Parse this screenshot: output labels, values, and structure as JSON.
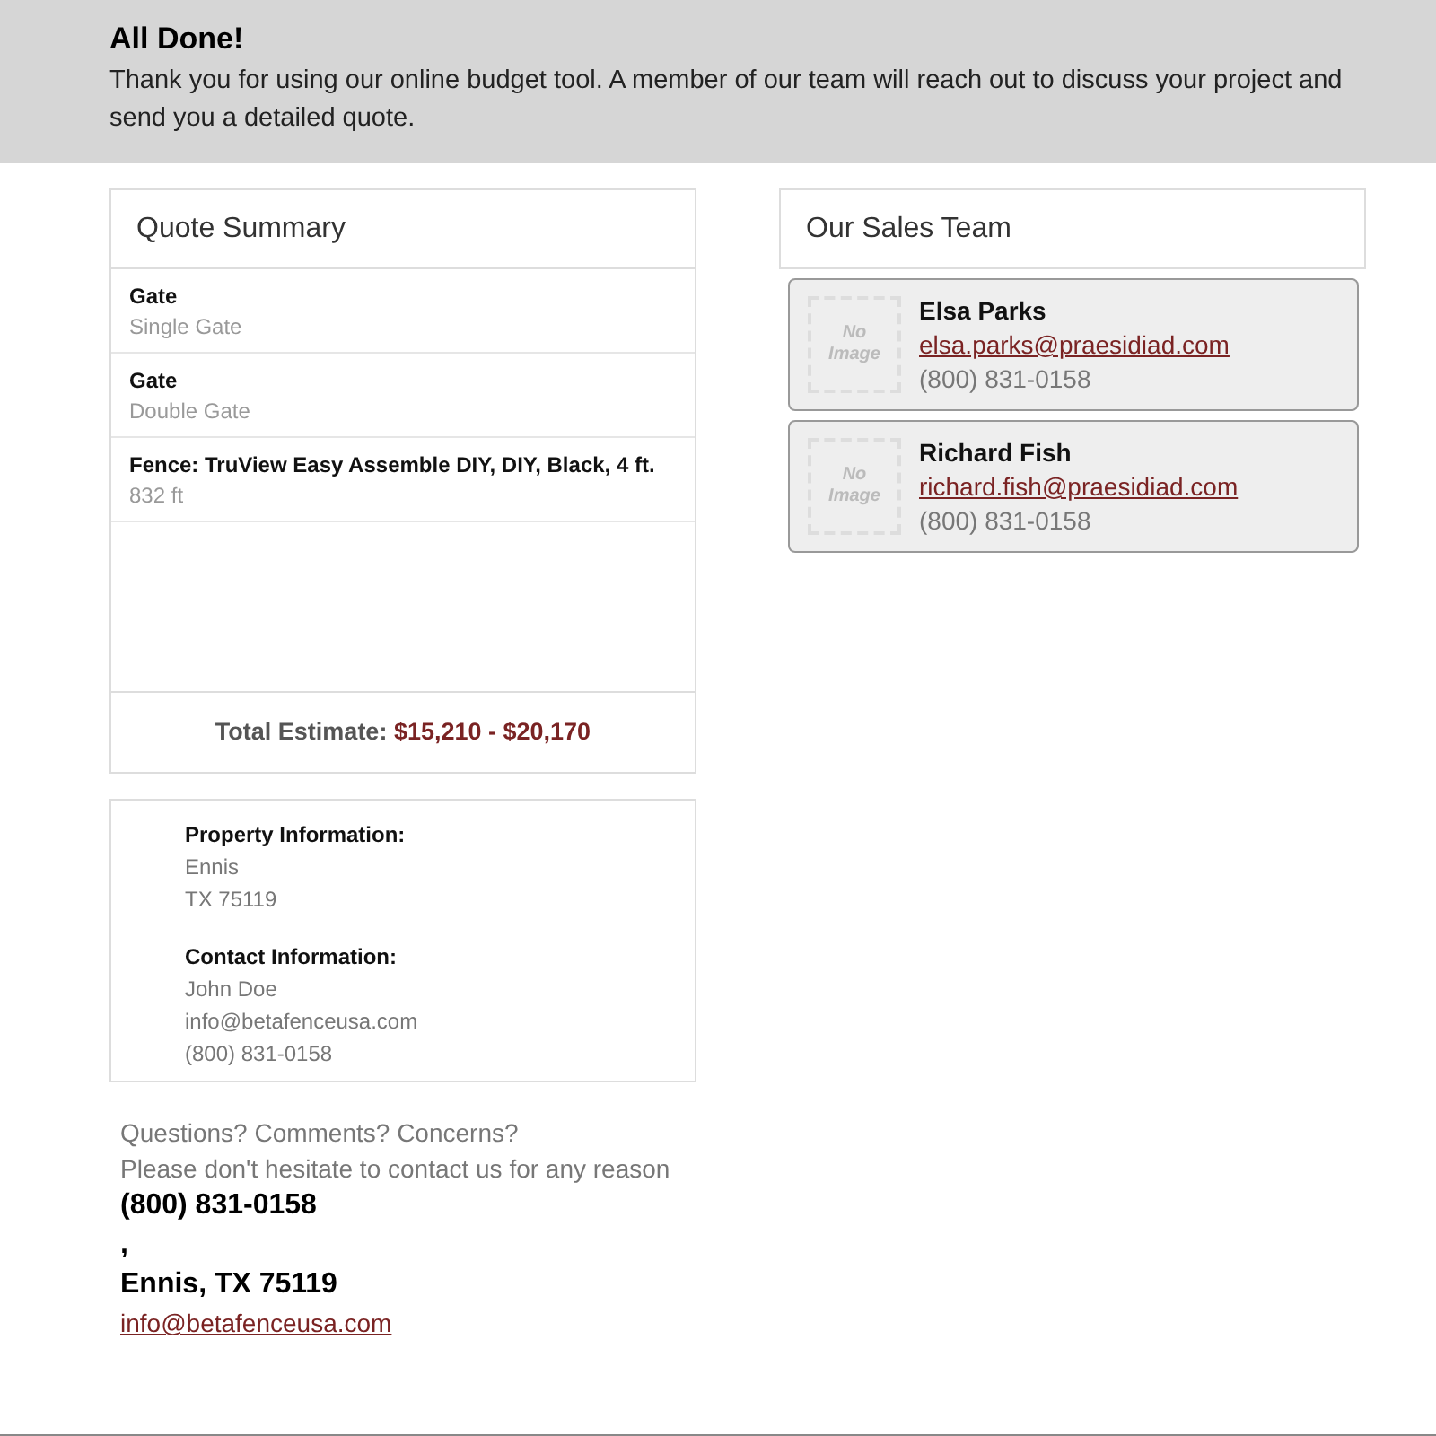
{
  "banner": {
    "title": "All Done!",
    "message": "Thank you for using our online budget tool. A member of our team will reach out to discuss your project and send you a detailed quote."
  },
  "quote_summary": {
    "title": "Quote Summary",
    "items": [
      {
        "name": "Gate",
        "detail": "Single Gate"
      },
      {
        "name": "Gate",
        "detail": "Double Gate"
      },
      {
        "name": "Fence: TruView Easy Assemble DIY, DIY, Black, 4 ft.",
        "detail": "832 ft"
      }
    ],
    "total_label": "Total Estimate:",
    "total_value": "$15,210 - $20,170"
  },
  "info": {
    "sections": [
      {
        "heading": "Property Information:",
        "lines": [
          "Ennis",
          "TX 75119"
        ]
      },
      {
        "heading": "Contact Information:",
        "lines": [
          "John Doe",
          "info@betafenceusa.com",
          "(800) 831-0158"
        ]
      }
    ]
  },
  "contact": {
    "lines": [
      "Questions? Comments? Concerns?",
      "Please don't hesitate to contact us for any reason"
    ],
    "phone": "(800) 831-0158",
    "comma": ",",
    "address": "Ennis, TX 75119",
    "email": "info@betafenceusa.com"
  },
  "sales_team": {
    "title": "Our Sales Team",
    "members": [
      {
        "photo": "No Image",
        "name": "Elsa Parks",
        "email": "elsa.parks@praesidiad.com",
        "phone": "(800) 831-0158"
      },
      {
        "photo": "No Image",
        "name": "Richard Fish",
        "email": "richard.fish@praesidiad.com",
        "phone": "(800) 831-0158"
      }
    ]
  }
}
